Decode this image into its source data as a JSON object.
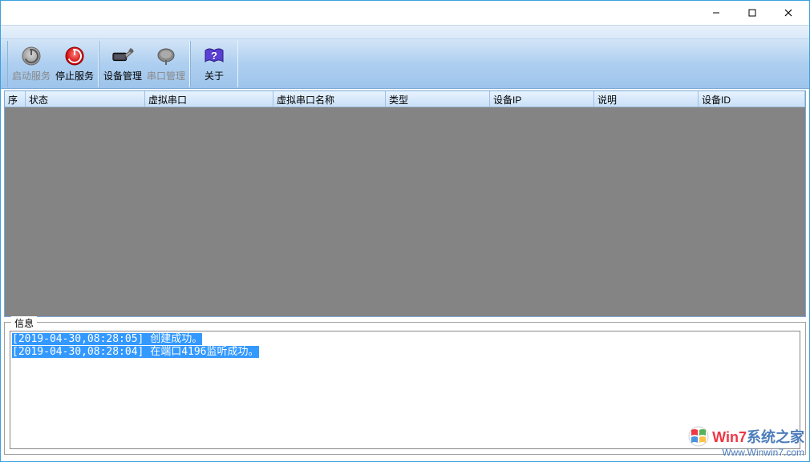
{
  "window": {
    "minimize": "—",
    "maximize": "☐",
    "close": "✕"
  },
  "toolbar": {
    "start_service": "启动服务",
    "stop_service": "停止服务",
    "device_mgmt": "设备管理",
    "serial_mgmt": "串口管理",
    "about": "关于"
  },
  "columns": {
    "seq": "序",
    "status": "状态",
    "vport": "虚拟串口",
    "vport_name": "虚拟串口名称",
    "type": "类型",
    "device_ip": "设备IP",
    "desc": "说明",
    "device_id": "设备ID"
  },
  "info": {
    "legend": "信息",
    "logs": [
      {
        "ts": "[2019-04-30,08:28:05]",
        "msg": " 创建成功。"
      },
      {
        "ts": "[2019-04-30,08:28:04]",
        "msg": " 在端口4196监听成功。"
      }
    ]
  },
  "watermark": {
    "brand_prefix": "Win7",
    "brand_suffix": "系统之家",
    "url": "Www.Winwin7.com"
  }
}
